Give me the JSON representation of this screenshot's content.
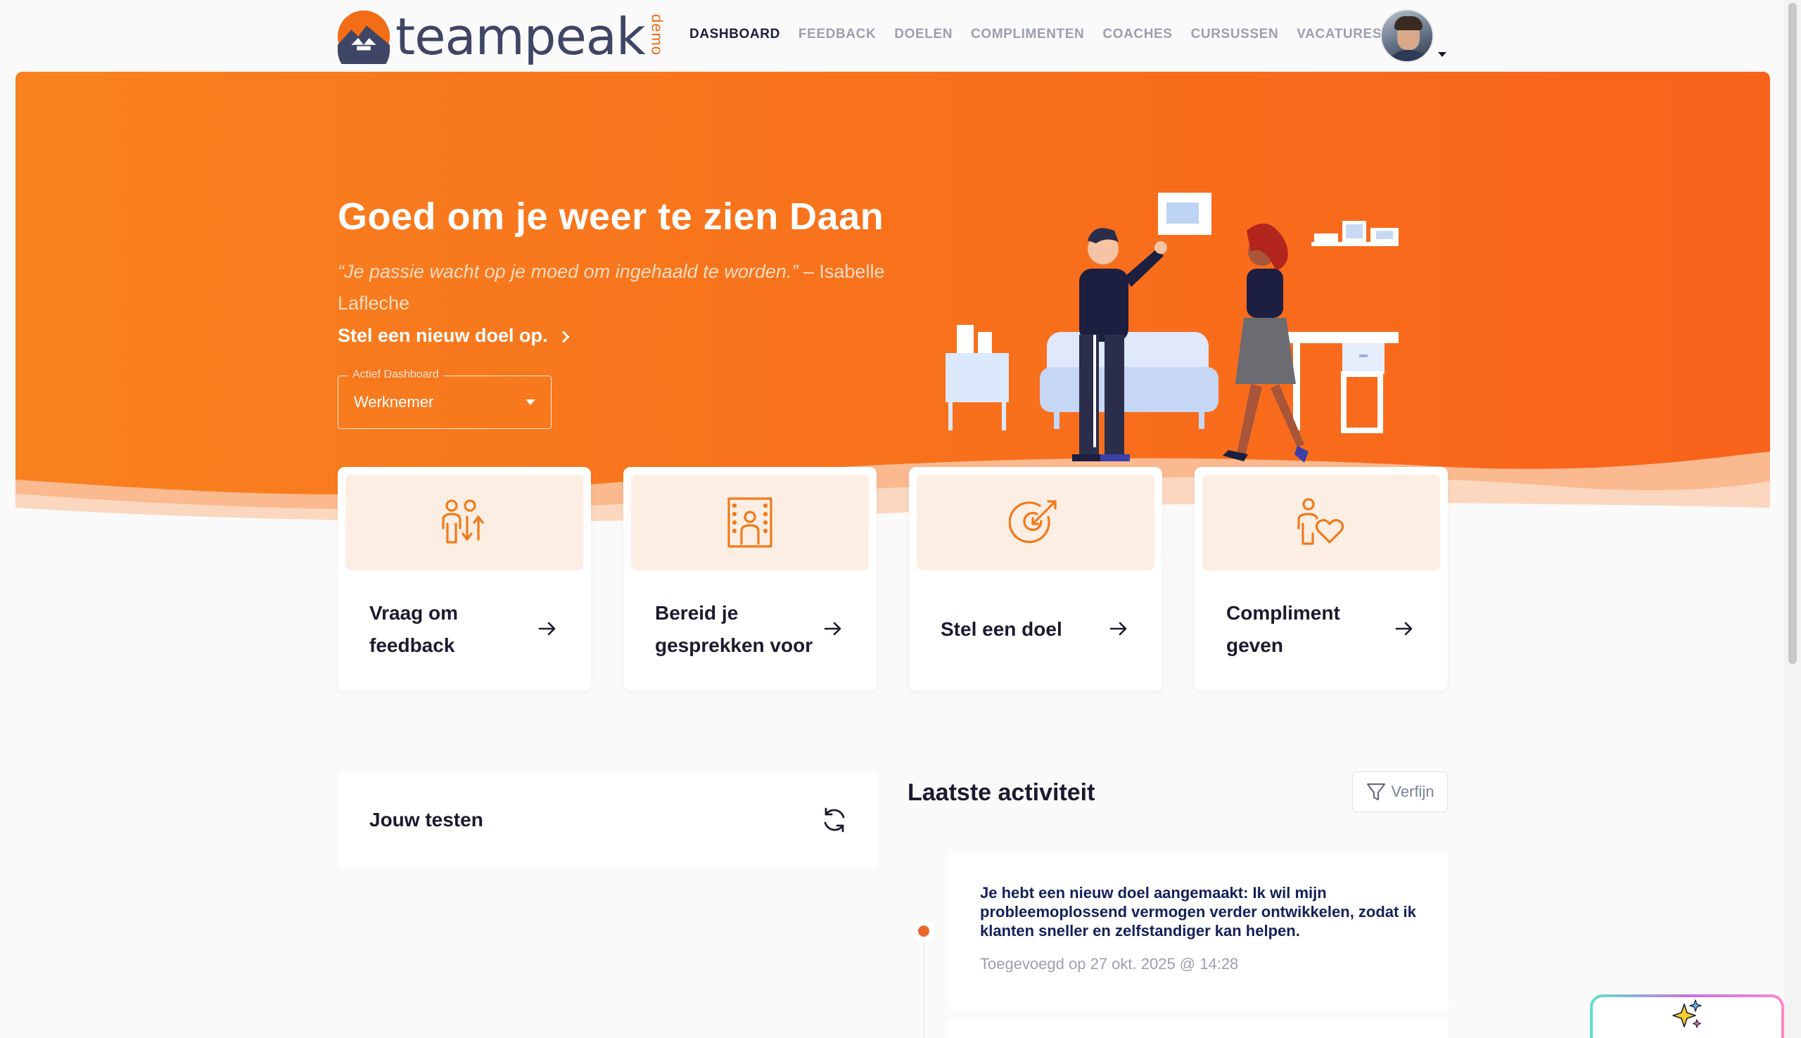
{
  "brand": {
    "name": "teampeak",
    "badge": "demo",
    "accent": "#f36c16",
    "dark": "#3e4565"
  },
  "nav": {
    "items": [
      {
        "label": "DASHBOARD",
        "active": true
      },
      {
        "label": "FEEDBACK",
        "active": false
      },
      {
        "label": "DOELEN",
        "active": false
      },
      {
        "label": "COMPLIMENTEN",
        "active": false
      },
      {
        "label": "COACHES",
        "active": false
      },
      {
        "label": "CURSUSSEN",
        "active": false
      },
      {
        "label": "VACATURES",
        "active": false
      }
    ]
  },
  "hero": {
    "title": "Goed om je weer te zien Daan",
    "quote": "“Je passie wacht op je moed om ingehaald te worden.”",
    "quote_author": " – Isabelle Lafleche",
    "cta": "Stel een nieuw doel op.",
    "dashboard_select": {
      "legend": "Actief Dashboard",
      "value": "Werknemer"
    }
  },
  "cards": [
    {
      "label": "Vraag om feedback",
      "icon": "feedback-exchange-icon"
    },
    {
      "label": "Bereid je gesprekken voor",
      "icon": "meeting-prep-icon"
    },
    {
      "label": "Stel een doel",
      "icon": "target-goal-icon"
    },
    {
      "label": "Compliment geven",
      "icon": "compliment-heart-icon"
    }
  ],
  "tests": {
    "title": "Jouw testen"
  },
  "activity": {
    "title": "Laatste activiteit",
    "filter_label": "Verfijn",
    "items": [
      {
        "text": "Je hebt een nieuw doel aangemaakt: Ik wil mijn probleemoplossend vermogen verder ontwikkelen, zodat ik klanten sneller en zelfstandiger kan helpen.",
        "date": "Toegevoegd op 27 okt. 2025 @ 14:28"
      }
    ]
  }
}
